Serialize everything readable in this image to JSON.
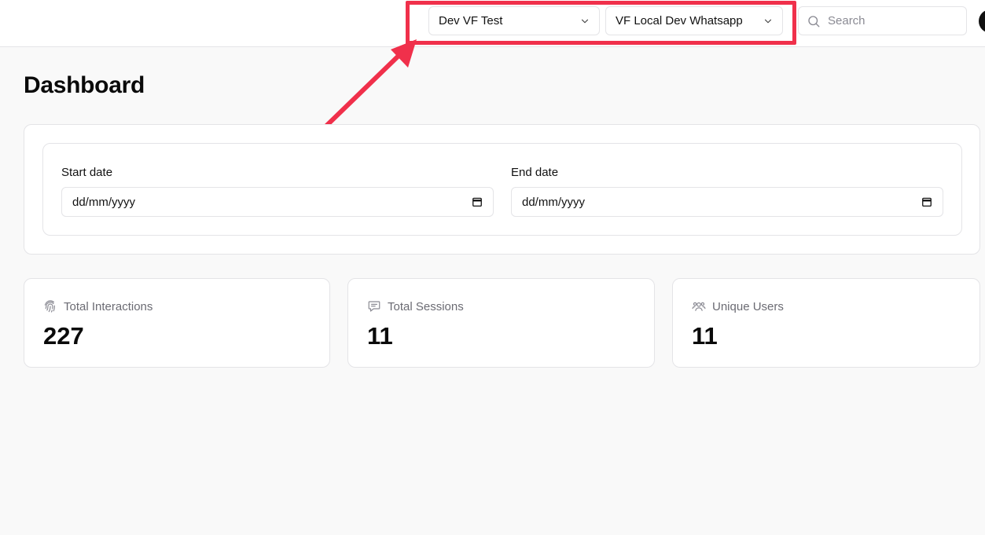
{
  "header": {
    "workspace_select": {
      "value": "Dev VF Test",
      "icon": "chevron-down-icon"
    },
    "project_select": {
      "value": "VF Local Dev Whatsapp",
      "icon": "chevron-down-icon"
    },
    "search": {
      "placeholder": "Search",
      "icon": "search-icon"
    },
    "avatar": {
      "icon": "avatar"
    }
  },
  "annotation": {
    "highlight_color": "#f0304b"
  },
  "page": {
    "title": "Dashboard"
  },
  "filters": {
    "start_date": {
      "label": "Start date",
      "placeholder": "dd/mm/yyyy",
      "icon": "calendar-icon"
    },
    "end_date": {
      "label": "End date",
      "placeholder": "dd/mm/yyyy",
      "icon": "calendar-icon"
    }
  },
  "stats": [
    {
      "label": "Total Interactions",
      "value": "227",
      "icon": "fingerprint-icon"
    },
    {
      "label": "Total Sessions",
      "value": "11",
      "icon": "message-icon"
    },
    {
      "label": "Unique Users",
      "value": "11",
      "icon": "users-icon"
    }
  ]
}
